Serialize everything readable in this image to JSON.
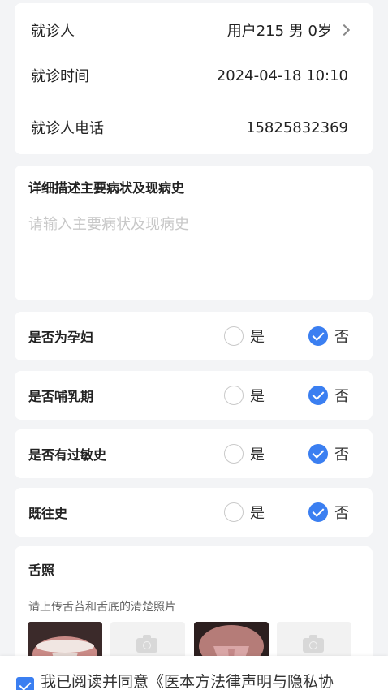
{
  "patient": {
    "name_label": "就诊人",
    "name_value": "用户215 男 0岁",
    "time_label": "就诊时间",
    "time_value": "2024-04-18 10:10",
    "phone_label": "就诊人电话",
    "phone_value": "15825832369"
  },
  "symptoms": {
    "title": "详细描述主要病状及现病史",
    "placeholder": "请输入主要病状及现病史",
    "value": ""
  },
  "questions": [
    {
      "label": "是否为孕妇",
      "yes": "是",
      "no": "否",
      "selected": "no"
    },
    {
      "label": "是否哺乳期",
      "yes": "是",
      "no": "否",
      "selected": "no"
    },
    {
      "label": "是否有过敏史",
      "yes": "是",
      "no": "否",
      "selected": "no"
    },
    {
      "label": "既往史",
      "yes": "是",
      "no": "否",
      "selected": "no"
    }
  ],
  "tongue": {
    "title": "舌照",
    "hint": "请上传舌苔和舌底的清楚照片"
  },
  "agreement": {
    "prefix": "我已阅读并同意",
    "link": "《医本方法律声明与隐私协",
    "checked": true
  },
  "colors": {
    "accent": "#3b7ff1",
    "background": "#f3f4f6"
  }
}
